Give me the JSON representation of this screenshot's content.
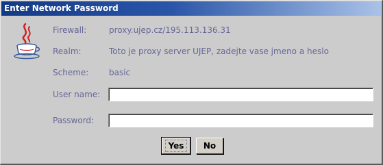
{
  "window": {
    "title": "Enter Network Password"
  },
  "fields": {
    "firewall_label": "Firewall:",
    "firewall_value": "proxy.ujep.cz/195.113.136.31",
    "realm_label": "Realm:",
    "realm_value": "Toto je proxy server UJEP, zadejte vase jmeno a heslo",
    "scheme_label": "Scheme:",
    "scheme_value": "basic",
    "username_label": "User name:",
    "username_value": "",
    "password_label": "Password:",
    "password_value": ""
  },
  "buttons": {
    "yes_label": "Yes",
    "no_label": "No"
  },
  "icons": {
    "app_icon": "java-coffee-cup-icon"
  },
  "colors": {
    "label_text": "#666699",
    "titlebar_start": "#133a86",
    "titlebar_end": "#a9c2e8",
    "dialog_bg": "#cccccc"
  }
}
